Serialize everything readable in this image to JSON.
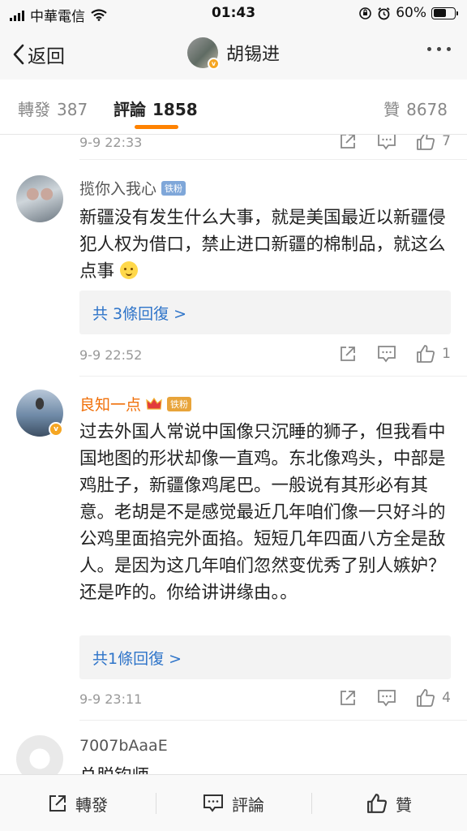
{
  "status_bar": {
    "carrier": "中華電信",
    "time": "01:43",
    "battery_percent": "60%",
    "battery_level": 0.6,
    "icons": [
      "signal-icon",
      "wifi-icon",
      "rotation-lock-icon",
      "alarm-icon",
      "battery-icon"
    ]
  },
  "nav": {
    "back_label": "返回",
    "title": "胡锡进",
    "more_icon": "more-dots-icon"
  },
  "tabs": {
    "repost": {
      "label": "轉發",
      "count": "387"
    },
    "comment": {
      "label": "評論",
      "count": "1858"
    },
    "like": {
      "label": "贊",
      "count": "8678"
    }
  },
  "comments": [
    {
      "time": "9-9 22:33",
      "likes": "7"
    },
    {
      "username": "揽你入我心",
      "badge": "铁粉",
      "text": "新疆没有发生什么大事，就是美国最近以新疆侵犯人权为借口，禁止进口新疆的棉制品，就这么点事",
      "replies": "共 3條回復 >",
      "time": "9-9 22:52",
      "likes": "1"
    },
    {
      "username": "良知一点",
      "badge": "铁粉",
      "text": "过去外国人常说中国像只沉睡的狮子，但我看中国地图的形状却像一直鸡。东北像鸡头，中部是鸡肚子，新疆像鸡尾巴。一般说有其形必有其意。老胡是不是感觉最近几年咱们像一只好斗的公鸡里面掐完外面掐。短短几年四面八方全是敌人。是因为这几年咱们忽然变优秀了别人嫉妒？还是咋的。你给讲讲缘由。。",
      "replies": "共1條回復 >",
      "time": "9-9 23:11",
      "likes": "4"
    },
    {
      "username": "7007bAaaE",
      "text": "总脱钩师"
    }
  ],
  "bottom_bar": {
    "repost_label": "轉發",
    "comment_label": "評論",
    "like_label": "贊"
  },
  "colors": {
    "accent": "#ff8200",
    "link_blue": "#2e74c9",
    "orange_name": "#f0700a",
    "verified_badge": "#f5a623"
  }
}
